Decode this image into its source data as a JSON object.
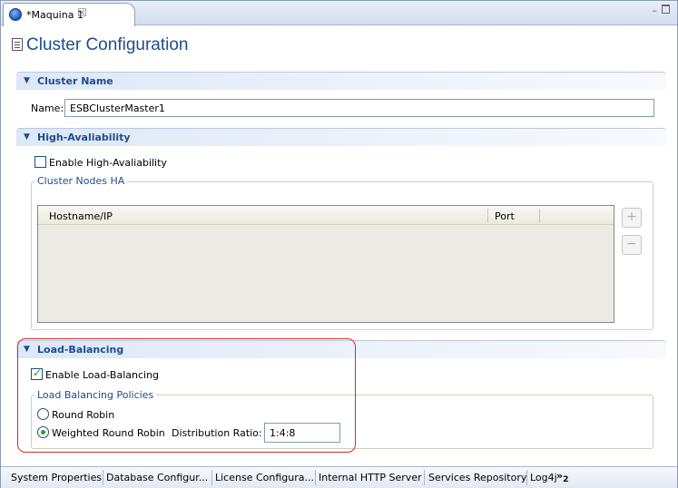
{
  "tab": {
    "title": "*Maquina 1",
    "close": "☒"
  },
  "window": {
    "minimize": "–"
  },
  "form": {
    "title": "Cluster Configuration"
  },
  "cluster_name": {
    "header": "Cluster Name",
    "name_label": "Name:",
    "name_value": "ESBClusterMaster1"
  },
  "ha": {
    "header": "High-Avaliability",
    "enable_label": "Enable High-Avaliability",
    "enabled": false,
    "group_title": "Cluster Nodes HA",
    "columns": [
      "Hostname/IP",
      "Port"
    ],
    "add_button": "+",
    "remove_button": "−"
  },
  "lb": {
    "header": "Load-Balancing",
    "enable_label": "Enable Load-Balancing",
    "enabled": true,
    "group_title": "Load Balancing Policies",
    "policies": [
      "Round Robin",
      "Weighted Round Robin"
    ],
    "selected_policy": "Weighted Round Robin",
    "ratio_label": "Distribution Ratio:",
    "ratio_value": "1:4:8"
  },
  "bottom_tabs": [
    "System Properties",
    "Database Configur...",
    "License Configura...",
    "Internal HTTP Server",
    "Services Repository",
    "Log4j"
  ],
  "more_tabs": {
    "chevron": "»",
    "count": "2"
  }
}
